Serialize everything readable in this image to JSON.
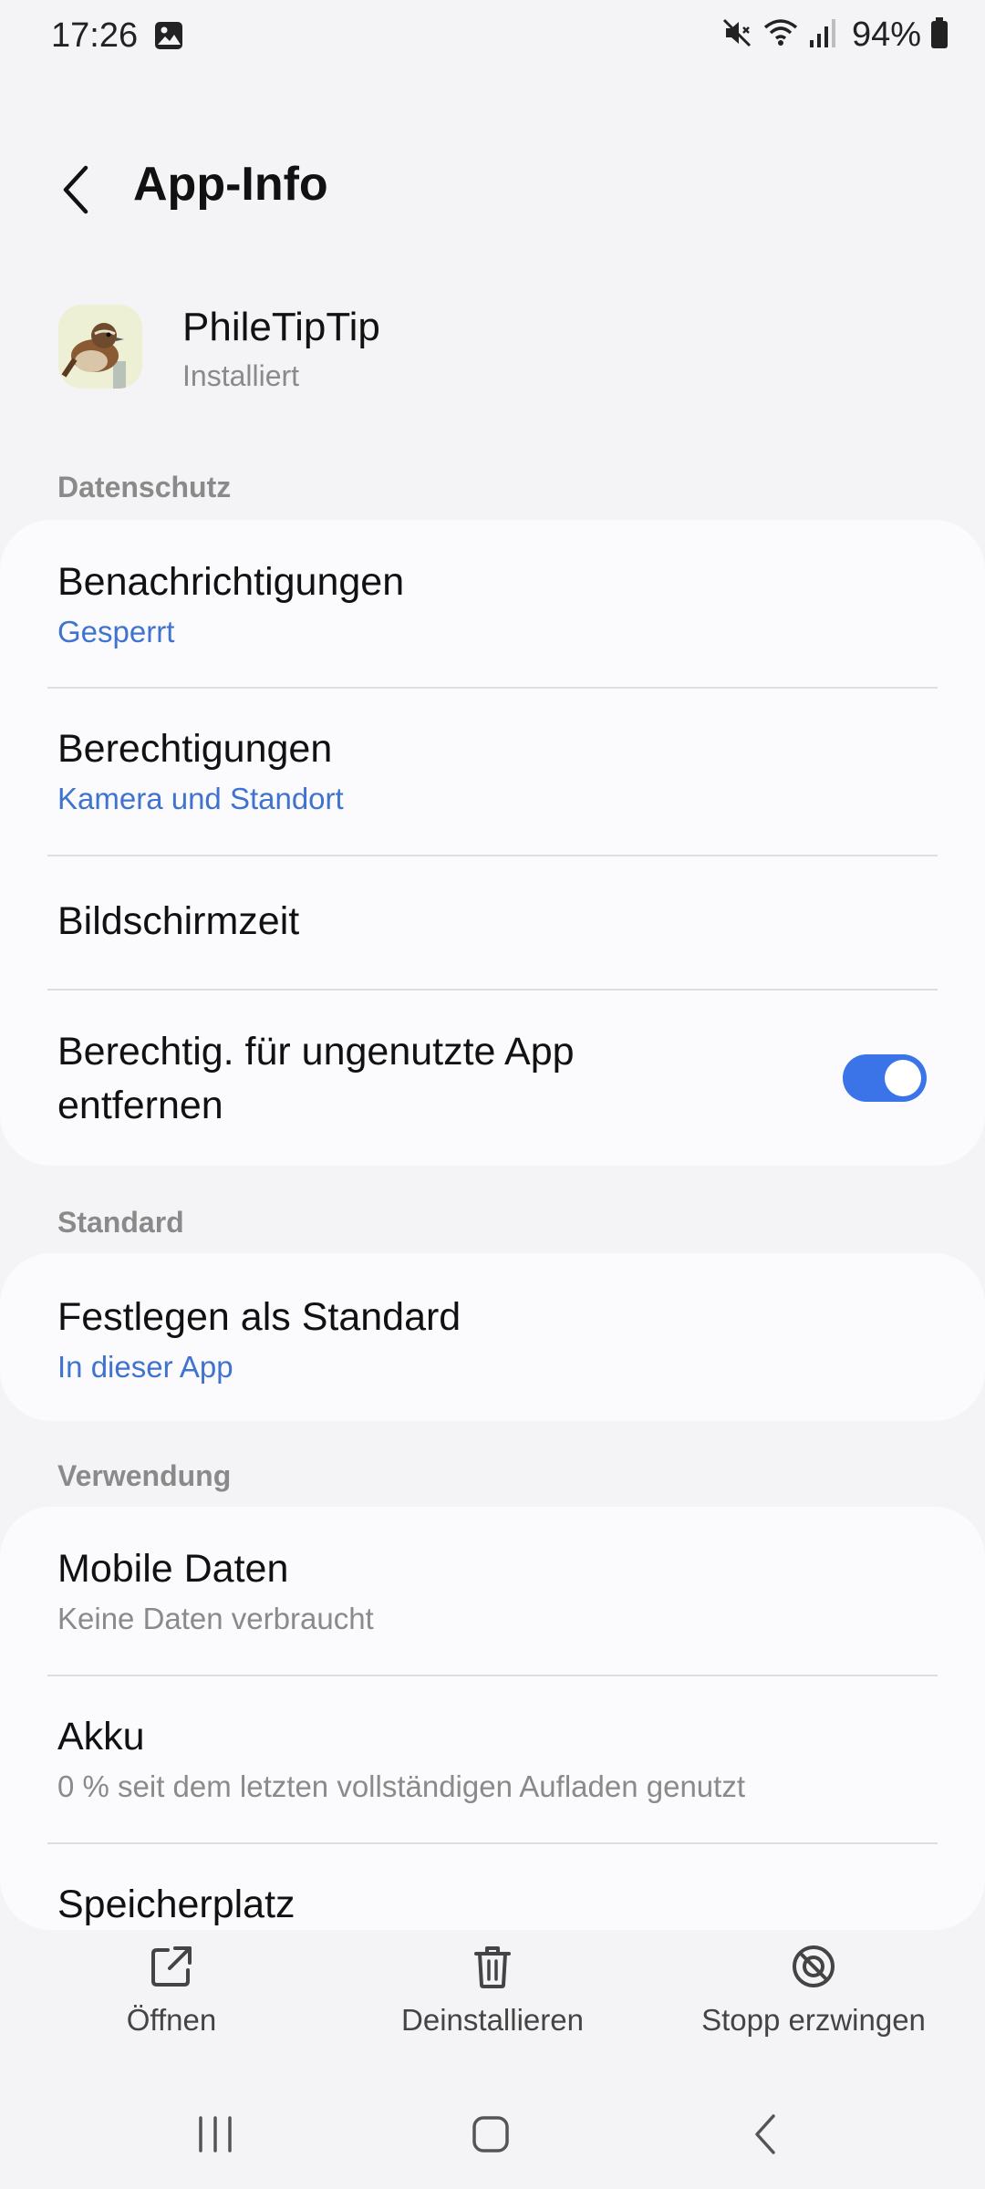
{
  "status_bar": {
    "time": "17:26",
    "battery_percent": "94%",
    "icons": [
      "image-icon",
      "mute-icon",
      "wifi-icon",
      "signal-icon",
      "battery-icon"
    ]
  },
  "header": {
    "title": "App-Info"
  },
  "app": {
    "name": "PhileTipTip",
    "status": "Installiert"
  },
  "sections": {
    "privacy": {
      "header": "Datenschutz",
      "notifications": {
        "title": "Benachrichtigungen",
        "sub": "Gesperrt"
      },
      "permissions": {
        "title": "Berechtigungen",
        "sub": "Kamera und Standort"
      },
      "screen_time": {
        "title": "Bildschirmzeit"
      },
      "remove_permissions": {
        "title_line1": "Berechtig. für ungenutzte App",
        "title_line2": "entfernen",
        "enabled": true
      }
    },
    "default": {
      "header": "Standard",
      "set_default": {
        "title": "Festlegen als Standard",
        "sub": "In dieser App"
      }
    },
    "usage": {
      "header": "Verwendung",
      "mobile_data": {
        "title": "Mobile Daten",
        "sub": "Keine Daten verbraucht"
      },
      "battery": {
        "title": "Akku",
        "sub": "0 % seit dem letzten vollständigen Aufladen genutzt"
      },
      "storage": {
        "title": "Speicherplatz"
      }
    }
  },
  "actions": {
    "open": "Öffnen",
    "uninstall": "Deinstallieren",
    "force_stop": "Stopp erzwingen"
  },
  "colors": {
    "accent": "#3a74e8",
    "link_text": "#3f73cf",
    "background": "#f4f4f7",
    "card": "#fbfbfd"
  }
}
